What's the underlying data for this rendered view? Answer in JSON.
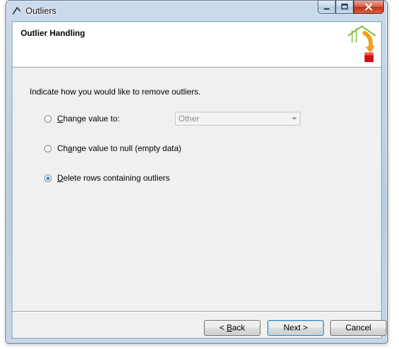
{
  "window": {
    "title": "Outliers",
    "controls": [
      "minimize",
      "maximize",
      "close"
    ]
  },
  "header": {
    "title": "Outlier Handling"
  },
  "content": {
    "instruction": "Indicate how you would like to remove outliers.",
    "options": [
      {
        "pre": "",
        "mnemonic": "C",
        "post": "hange value to:",
        "checked": false
      },
      {
        "pre": "Ch",
        "mnemonic": "a",
        "post": "nge value to null (empty data)",
        "checked": false
      },
      {
        "pre": "",
        "mnemonic": "D",
        "post": "elete rows containing outliers",
        "checked": true
      }
    ],
    "replacement_combo": {
      "value": "Other",
      "enabled": false
    }
  },
  "footer": {
    "back": {
      "pre": "< ",
      "mnemonic": "B",
      "post": "ack"
    },
    "next": "Next >",
    "cancel": "Cancel"
  }
}
